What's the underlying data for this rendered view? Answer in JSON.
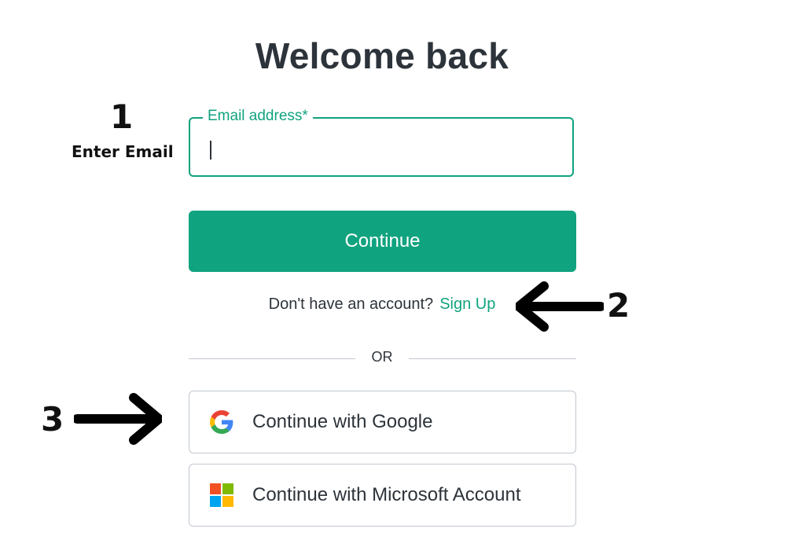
{
  "page": {
    "title": "Welcome back"
  },
  "annotations": {
    "step1_number": "1",
    "step1_caption": "Enter Email",
    "step2_number": "2",
    "step3_number": "3"
  },
  "email": {
    "label": "Email address*",
    "value": "",
    "placeholder": ""
  },
  "continue_button": {
    "label": "Continue"
  },
  "signup": {
    "prompt": "Don't have an account?",
    "link_label": "Sign Up"
  },
  "divider": {
    "label": "OR"
  },
  "social": {
    "google_label": "Continue with Google",
    "google_icon": "google-icon",
    "microsoft_label": "Continue with Microsoft Account",
    "microsoft_icon": "microsoft-icon"
  },
  "colors": {
    "accent": "#10a37f",
    "text": "#2d333a",
    "border": "#c2c8d0",
    "google_blue": "#4285F4",
    "google_red": "#EA4335",
    "google_yellow": "#FBBC05",
    "google_green": "#34A853",
    "ms_red": "#F25022",
    "ms_green": "#7FBA00",
    "ms_blue": "#00A4EF",
    "ms_yellow": "#FFB900"
  }
}
